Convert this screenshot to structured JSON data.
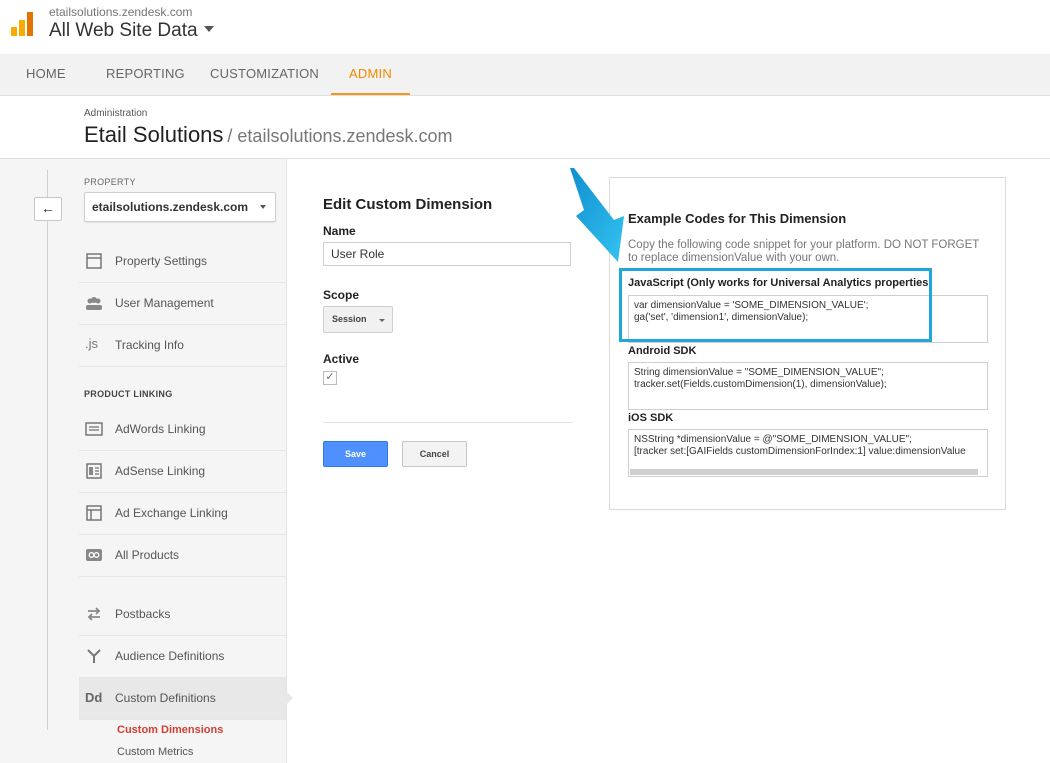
{
  "header": {
    "account": "etailsolutions.zendesk.com",
    "view": "All Web Site Data"
  },
  "nav": {
    "tabs": [
      {
        "label": "HOME"
      },
      {
        "label": "REPORTING"
      },
      {
        "label": "CUSTOMIZATION"
      },
      {
        "label": "ADMIN"
      }
    ]
  },
  "page": {
    "breadcrumb": "Administration",
    "title": "Etail Solutions",
    "subtitle": "/ etailsolutions.zendesk.com"
  },
  "sidebar": {
    "property_label": "PROPERTY",
    "property_value": "etailsolutions.zendesk.com",
    "items": [
      {
        "label": "Property Settings",
        "icon": "page-icon"
      },
      {
        "label": "User Management",
        "icon": "users-icon"
      },
      {
        "label": "Tracking Info",
        "icon": "js-icon"
      }
    ],
    "product_linking_label": "PRODUCT LINKING",
    "linking_items": [
      {
        "label": "AdWords Linking",
        "icon": "adwords-icon"
      },
      {
        "label": "AdSense Linking",
        "icon": "adsense-icon"
      },
      {
        "label": "Ad Exchange Linking",
        "icon": "adexchange-icon"
      },
      {
        "label": "All Products",
        "icon": "link-icon"
      }
    ],
    "other_items": [
      {
        "label": "Postbacks",
        "icon": "postbacks-icon"
      },
      {
        "label": "Audience Definitions",
        "icon": "audience-icon"
      },
      {
        "label": "Custom Definitions",
        "icon": "dd-icon"
      }
    ],
    "sub_items": [
      {
        "label": "Custom Dimensions"
      },
      {
        "label": "Custom Metrics"
      }
    ]
  },
  "form": {
    "title": "Edit Custom Dimension",
    "name_label": "Name",
    "name_value": "User Role",
    "scope_label": "Scope",
    "scope_value": "Session",
    "active_label": "Active",
    "active_checked": true,
    "save_label": "Save",
    "cancel_label": "Cancel"
  },
  "examples": {
    "title": "Example Codes for This Dimension",
    "description": "Copy the following code snippet for your platform. DO NOT FORGET to replace dimensionValue with your own.",
    "js_label": "JavaScript (Only works for Universal Analytics properties",
    "js_lines": [
      "var dimensionValue = 'SOME_DIMENSION_VALUE';",
      "ga('set', 'dimension1', dimensionValue);"
    ],
    "android_label": "Android SDK",
    "android_lines": [
      "String dimensionValue = \"SOME_DIMENSION_VALUE\";",
      "tracker.set(Fields.customDimension(1), dimensionValue);"
    ],
    "ios_label": "iOS SDK",
    "ios_lines": [
      "NSString *dimensionValue = @\"SOME_DIMENSION_VALUE\";",
      "[tracker set:[GAIFields customDimensionForIndex:1] value:dimensionValue"
    ]
  },
  "colors": {
    "accent": "#ef8b00",
    "primary_button": "#4d90fe",
    "highlight": "#1ea7d8",
    "selected_subitem": "#d23f31"
  }
}
